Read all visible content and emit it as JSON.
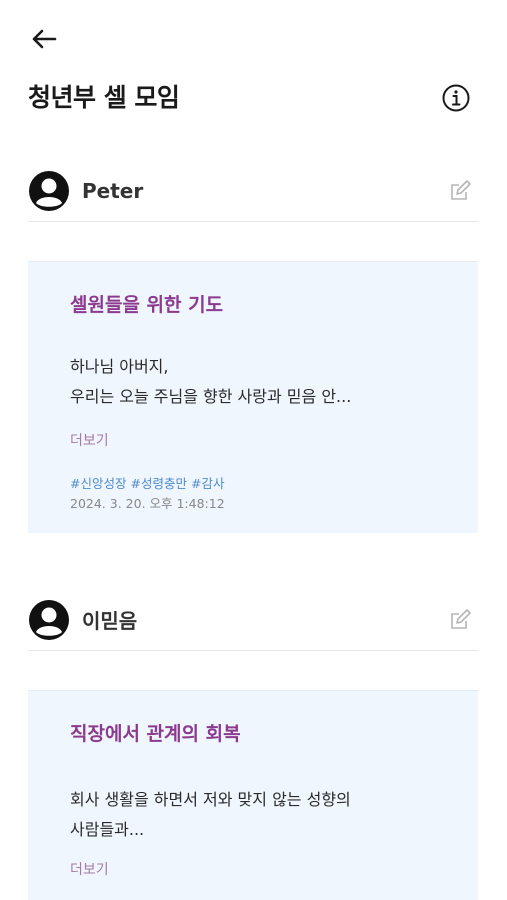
{
  "header": {
    "back_icon": "arrow-left-icon",
    "title": "청년부 셀 모임",
    "info_icon": "info-circle-icon"
  },
  "posts": [
    {
      "author": "Peter",
      "title": "셀원들을 위한 기도",
      "body_line1": "하나님 아버지,",
      "body_line2": "우리는 오늘 주님을 향한 사랑과 믿음 안...",
      "more_label": "더보기",
      "tags": [
        "#신앙성장",
        "#성령충만",
        "#감사"
      ],
      "timestamp": "2024. 3. 20. 오후 1:48:12"
    },
    {
      "author": "이믿음",
      "title": "직장에서 관계의 회복",
      "body_line1": "회사 생활을 하면서 저와 맞지 않는 성향의",
      "body_line2": "사람들과...",
      "more_label": "더보기"
    }
  ],
  "colors": {
    "card_bg": "#f0f6fd",
    "title_purple": "#8b3a8f",
    "tag_blue": "#4e8ccd",
    "more_purple": "#a67aa8"
  }
}
